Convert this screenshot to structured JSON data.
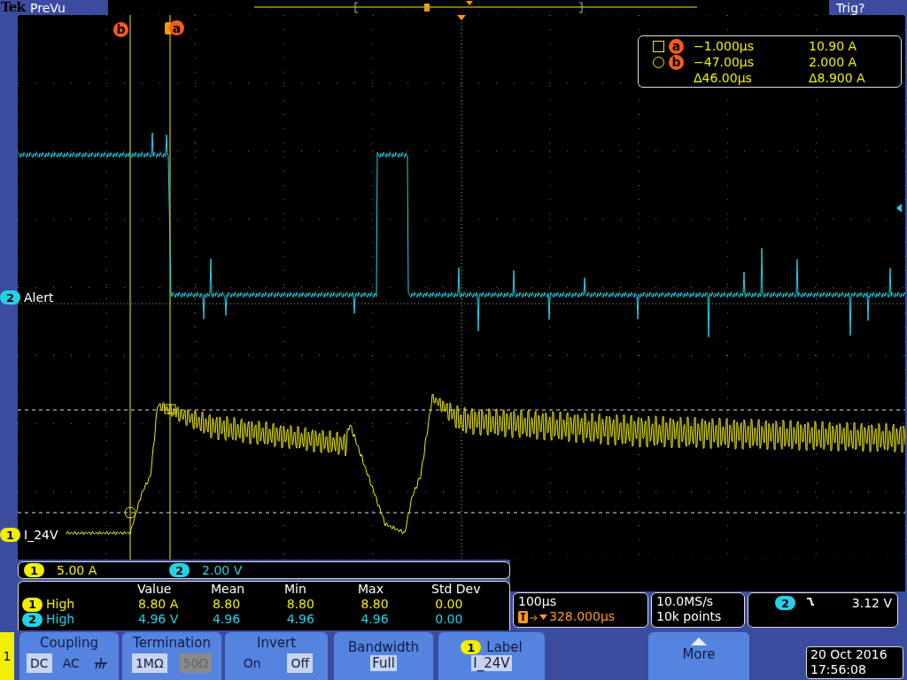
{
  "header": {
    "brand": "Tek",
    "mode": "PreVu",
    "trigger_status": "Trig?"
  },
  "cursor_labels": [
    {
      "text": "b"
    },
    {
      "text": "a"
    }
  ],
  "channel_markers": [
    {
      "number": "2",
      "label": "Alert",
      "color": "#22d3e6"
    },
    {
      "number": "1",
      "label": "I_24V",
      "color": "#f2ee00"
    }
  ],
  "cursor_readout": [
    {
      "kind": "square",
      "marker": "a",
      "time": "−1.000µs",
      "value": "10.90 A"
    },
    {
      "kind": "circle",
      "marker": "b",
      "time": "−47.00µs",
      "value": "2.000 A"
    },
    {
      "kind": "delta",
      "time": "Δ46.00µs",
      "value": "Δ8.900 A"
    }
  ],
  "channel_scales": [
    {
      "number": "1",
      "scale": "5.00 A",
      "color": "#f2ee00"
    },
    {
      "number": "2",
      "scale": "2.00 V",
      "color": "#22d3e6"
    }
  ],
  "measurements": {
    "columns": [
      "Value",
      "Mean",
      "Min",
      "Max",
      "Std Dev"
    ],
    "rows": [
      {
        "channel": "1",
        "type": "High",
        "color": "#f2ee00",
        "cells": [
          "8.80 A",
          "8.80",
          "8.80",
          "8.80",
          "0.00"
        ]
      },
      {
        "channel": "2",
        "type": "High",
        "color": "#22d3e6",
        "cells": [
          "4.96 V",
          "4.96",
          "4.96",
          "4.96",
          "0.00"
        ]
      }
    ]
  },
  "timebase": {
    "scale": "100µs",
    "trigger_position": "328.000µs"
  },
  "acquisition": {
    "sample_rate": "10.0MS/s",
    "record_length": "10k points"
  },
  "trigger": {
    "channel": "2",
    "level": "3.12 V"
  },
  "menu": {
    "channel": "1",
    "buttons": [
      {
        "kind": "options",
        "title": "Coupling",
        "options": [
          {
            "kind": "text",
            "label": "DC",
            "selected": true,
            "disabled": false
          },
          {
            "kind": "text",
            "label": "AC",
            "selected": false,
            "disabled": false
          },
          {
            "kind": "ground",
            "selected": false,
            "disabled": false
          }
        ]
      },
      {
        "kind": "options",
        "title": "Termination",
        "options": [
          {
            "kind": "text",
            "label": "1MΩ",
            "selected": true,
            "disabled": false
          },
          {
            "kind": "text",
            "label": "50Ω",
            "selected": false,
            "disabled": true
          }
        ]
      },
      {
        "kind": "options",
        "title": "Invert",
        "options": [
          {
            "kind": "text",
            "label": "On",
            "selected": false,
            "disabled": false
          },
          {
            "kind": "text",
            "label": "Off",
            "selected": true,
            "disabled": false
          }
        ]
      },
      {
        "kind": "value",
        "title": "Bandwidth",
        "value": "Full"
      },
      {
        "kind": "label",
        "channel": "1",
        "title": "Label",
        "value": "I_24V"
      },
      {
        "kind": "more",
        "title": "More"
      }
    ]
  },
  "datetime": {
    "date": "20 Oct 2016",
    "time": "17:56:08"
  }
}
